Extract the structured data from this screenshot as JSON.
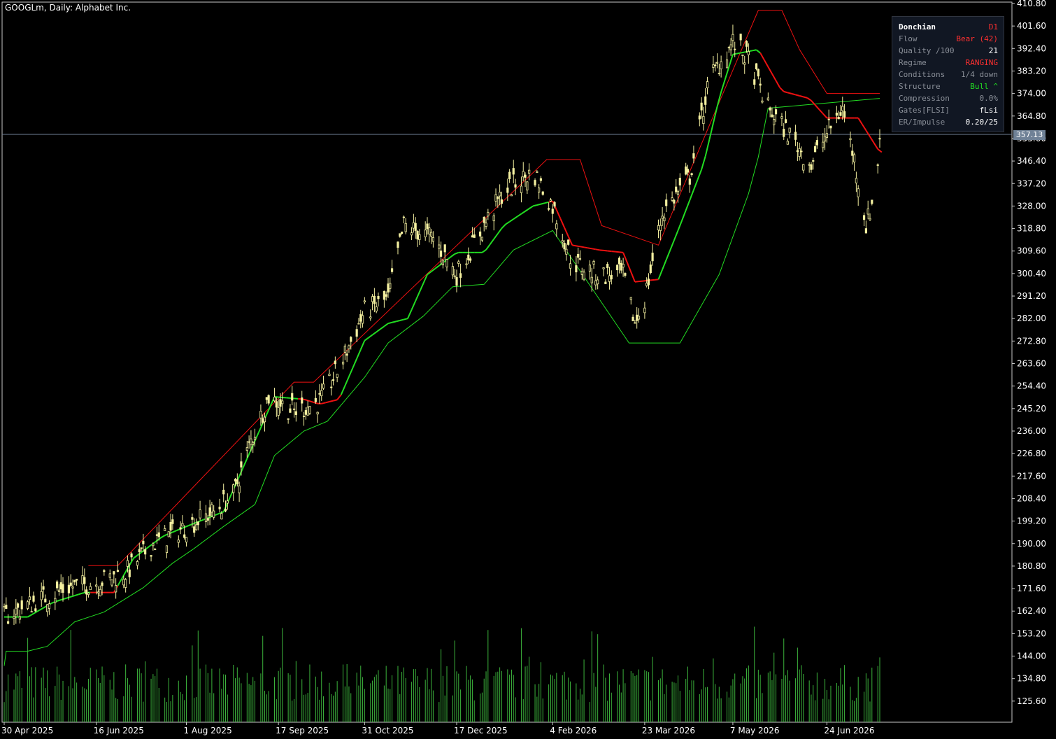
{
  "chart_title": "GOOGLm, Daily:  Alphabet Inc.",
  "current_price": "357.13",
  "colors": {
    "background": "#000000",
    "candle": "#f4f0a0",
    "bull_line": "#22dd22",
    "bear_line": "#ee1111",
    "volume": "#3cb43c",
    "axis": "#ffffff",
    "price_line": "#6f8196"
  },
  "panel": {
    "rows": [
      {
        "label": "Donchian",
        "value": "D1",
        "color": "#ff3030"
      },
      {
        "label": "Flow",
        "value": "Bear (42)",
        "color": "#ff3030"
      },
      {
        "label": "Quality /100",
        "value": "21",
        "color": "#ffffff"
      },
      {
        "label": "Regime",
        "value": "RANGING",
        "color": "#ff3030"
      },
      {
        "label": "Conditions",
        "value": "1/4 down",
        "color": "#8a8f98"
      },
      {
        "label": "Structure",
        "value": "Bull ^",
        "color": "#22dd22"
      },
      {
        "label": "Compression",
        "value": "0.0%",
        "color": "#8a8f98"
      },
      {
        "label": "Gates[FLSI]",
        "value": "fLsi",
        "color": "#ffffff"
      },
      {
        "label": "ER/Impulse",
        "value": "0.20/25",
        "color": "#ffffff"
      }
    ]
  },
  "chart_data": {
    "type": "candlestick",
    "ylim": [
      116.4,
      410.8
    ],
    "y_ticks": [
      "410.80",
      "401.60",
      "392.40",
      "383.20",
      "374.00",
      "364.80",
      "355.60",
      "346.40",
      "337.20",
      "328.00",
      "318.80",
      "309.60",
      "300.40",
      "291.20",
      "282.00",
      "272.80",
      "263.60",
      "254.40",
      "245.20",
      "236.00",
      "226.80",
      "217.60",
      "208.40",
      "199.20",
      "190.00",
      "180.80",
      "171.60",
      "162.40",
      "153.20",
      "144.00",
      "134.80",
      "125.60"
    ],
    "x_ticks": [
      "30 Apr 2025",
      "16 Jun 2025",
      "1 Aug 2025",
      "17 Sep 2025",
      "31 Oct 2025",
      "17 Dec 2025",
      "4 Feb 2026",
      "23 Mar 2026",
      "7 May 2026",
      "24 Jun 2026"
    ],
    "close_trend": [
      [
        "2025-04-30",
        160
      ],
      [
        "2025-05-15",
        166
      ],
      [
        "2025-06-01",
        172
      ],
      [
        "2025-06-16",
        174
      ],
      [
        "2025-07-01",
        178
      ],
      [
        "2025-07-15",
        190
      ],
      [
        "2025-08-01",
        197
      ],
      [
        "2025-08-15",
        203
      ],
      [
        "2025-08-25",
        210
      ],
      [
        "2025-09-03",
        232
      ],
      [
        "2025-09-12",
        250
      ],
      [
        "2025-09-25",
        244
      ],
      [
        "2025-10-08",
        248
      ],
      [
        "2025-10-18",
        262
      ],
      [
        "2025-10-31",
        285
      ],
      [
        "2025-11-12",
        290
      ],
      [
        "2025-11-20",
        320
      ],
      [
        "2025-12-05",
        315
      ],
      [
        "2025-12-17",
        300
      ],
      [
        "2025-12-31",
        320
      ],
      [
        "2026-01-10",
        334
      ],
      [
        "2026-01-25",
        342
      ],
      [
        "2026-02-04",
        328
      ],
      [
        "2026-02-14",
        305
      ],
      [
        "2026-02-28",
        300
      ],
      [
        "2026-03-12",
        300
      ],
      [
        "2026-03-18",
        280
      ],
      [
        "2026-03-23",
        290
      ],
      [
        "2026-04-01",
        325
      ],
      [
        "2026-04-15",
        340
      ],
      [
        "2026-04-25",
        380
      ],
      [
        "2026-05-07",
        395
      ],
      [
        "2026-05-15",
        388
      ],
      [
        "2026-05-25",
        368
      ],
      [
        "2026-06-07",
        355
      ],
      [
        "2026-06-16",
        345
      ],
      [
        "2026-06-24",
        358
      ],
      [
        "2026-07-02",
        368
      ],
      [
        "2026-07-08",
        347
      ],
      [
        "2026-07-14",
        320
      ],
      [
        "2026-07-19",
        335
      ],
      [
        "2026-07-21",
        357
      ]
    ],
    "donchian_mid": [
      [
        "2025-04-30",
        160
      ],
      [
        "2025-05-12",
        160
      ],
      [
        "2025-05-25",
        166
      ],
      [
        "2025-06-10",
        170
      ],
      [
        "2025-06-25",
        170
      ],
      [
        "2025-07-05",
        184
      ],
      [
        "2025-07-20",
        193
      ],
      [
        "2025-08-01",
        197
      ],
      [
        "2025-08-20",
        203
      ],
      [
        "2025-09-05",
        232
      ],
      [
        "2025-09-15",
        250
      ],
      [
        "2025-09-30",
        249
      ],
      [
        "2025-10-08",
        247
      ],
      [
        "2025-10-18",
        249
      ],
      [
        "2025-10-31",
        273
      ],
      [
        "2025-11-12",
        280
      ],
      [
        "2025-11-22",
        282
      ],
      [
        "2025-12-02",
        300
      ],
      [
        "2025-12-17",
        309
      ],
      [
        "2025-12-31",
        309
      ],
      [
        "2026-01-10",
        320
      ],
      [
        "2026-01-25",
        328
      ],
      [
        "2026-02-04",
        330
      ],
      [
        "2026-02-14",
        312
      ],
      [
        "2026-02-28",
        310
      ],
      [
        "2026-03-12",
        309
      ],
      [
        "2026-03-18",
        297
      ],
      [
        "2026-03-30",
        298
      ],
      [
        "2026-04-10",
        320
      ],
      [
        "2026-04-22",
        345
      ],
      [
        "2026-04-30",
        372
      ],
      [
        "2026-05-07",
        390
      ],
      [
        "2026-05-20",
        392
      ],
      [
        "2026-06-01",
        375
      ],
      [
        "2026-06-15",
        372
      ],
      [
        "2026-06-24",
        364
      ],
      [
        "2026-07-10",
        364
      ],
      [
        "2026-07-21",
        350
      ]
    ],
    "donchian_bull_segments": [
      [
        "2025-04-30",
        "2025-06-12"
      ],
      [
        "2025-06-27",
        "2025-09-25"
      ],
      [
        "2025-10-18",
        "2026-02-01"
      ],
      [
        "2026-03-30",
        "2026-05-20"
      ]
    ],
    "donchian_lower": [
      [
        "2025-04-30",
        140
      ],
      [
        "2025-05-01",
        146
      ],
      [
        "2025-05-12",
        146
      ],
      [
        "2025-05-22",
        148
      ],
      [
        "2025-06-05",
        158
      ],
      [
        "2025-06-20",
        162
      ],
      [
        "2025-07-10",
        172
      ],
      [
        "2025-07-25",
        182
      ],
      [
        "2025-08-05",
        188
      ],
      [
        "2025-08-20",
        197
      ],
      [
        "2025-09-05",
        206
      ],
      [
        "2025-09-15",
        226
      ],
      [
        "2025-09-30",
        236
      ],
      [
        "2025-10-12",
        240
      ],
      [
        "2025-10-31",
        258
      ],
      [
        "2025-11-12",
        272
      ],
      [
        "2025-11-30",
        283
      ],
      [
        "2025-12-15",
        295
      ],
      [
        "2025-12-31",
        296
      ],
      [
        "2026-01-15",
        310
      ],
      [
        "2026-02-04",
        318
      ],
      [
        "2026-03-15",
        272
      ],
      [
        "2026-04-10",
        272
      ],
      [
        "2026-04-30",
        300
      ],
      [
        "2026-05-15",
        333
      ],
      [
        "2026-05-20",
        348
      ],
      [
        "2026-05-25",
        368
      ],
      [
        "2026-07-21",
        372
      ]
    ],
    "donchian_upper_bear": [
      [
        "2025-06-12",
        181
      ],
      [
        "2025-06-27",
        181
      ],
      [
        "2025-09-25",
        256
      ],
      [
        "2025-10-05",
        256
      ],
      [
        "2026-02-01",
        347
      ],
      [
        "2026-02-18",
        347
      ],
      [
        "2026-03-01",
        320
      ],
      [
        "2026-03-30",
        312
      ],
      [
        "2026-05-20",
        408
      ],
      [
        "2026-06-01",
        408
      ],
      [
        "2026-06-10",
        392
      ],
      [
        "2026-06-24",
        374
      ],
      [
        "2026-07-21",
        374
      ]
    ],
    "volume_range": [
      0,
      100
    ]
  }
}
